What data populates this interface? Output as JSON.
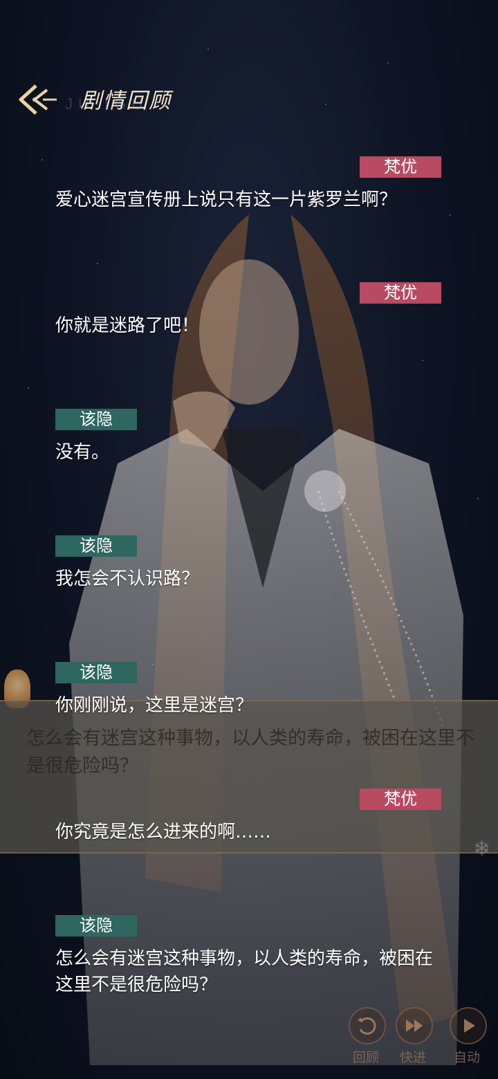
{
  "header": {
    "title": "剧情回顾",
    "subtitle": "JU    IGU"
  },
  "dialog": [
    {
      "speaker": "梵优",
      "side": "right",
      "text": "爱心迷宫宣传册上说只有这一片紫罗兰啊？"
    },
    {
      "speaker": "梵优",
      "side": "right",
      "text": "你就是迷路了吧！"
    },
    {
      "speaker": "该隐",
      "side": "left",
      "text": "没有。"
    },
    {
      "speaker": "该隐",
      "side": "left",
      "text": "我怎会不认识路？"
    },
    {
      "speaker": "该隐",
      "side": "left",
      "text": "你刚刚说，这里是迷宫？"
    },
    {
      "speaker": "梵优",
      "side": "right",
      "text": "你究竟是怎么进来的啊……"
    },
    {
      "speaker": "该隐",
      "side": "left",
      "text": "怎么会有迷宫这种事物，以人类的寿命，被困在这里不是很危险吗？"
    }
  ],
  "background_dialog": {
    "text": "怎么会有迷宫这种事物，以人类的寿命，被困在这里不是很危险吗？"
  },
  "controls": {
    "review_label": "回顾",
    "fast_forward_label": "快进",
    "auto_label": "自动"
  },
  "colors": {
    "speaker_right": "#b84a62",
    "speaker_left": "#2e6660",
    "text": "#ffffff",
    "title": "#f3e6cc"
  },
  "icons": {
    "back": "arrow-back-icon",
    "review": "replay-icon",
    "fast_forward": "fast-forward-icon",
    "auto": "play-icon"
  }
}
